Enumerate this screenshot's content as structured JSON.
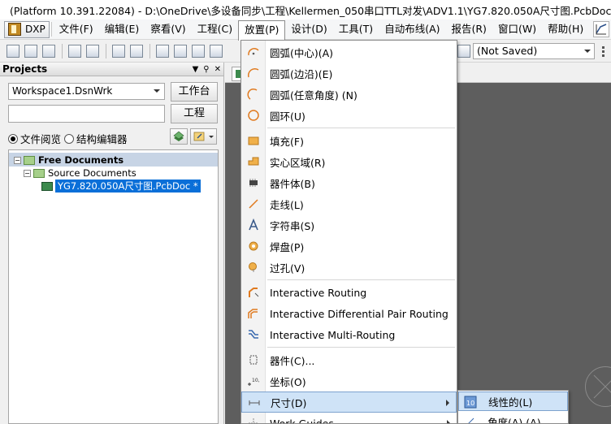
{
  "titlebar": {
    "title": "(Platform 10.391.22084) - D:\\OneDrive\\多设备同步\\工程\\Kellermen_050串口TTL对发\\ADV1.1\\YG7.820.050A尺寸图.PcbDoc * - Fre"
  },
  "menubar": {
    "dxp": "DXP",
    "items": [
      {
        "label": "文件(F)",
        "active": false
      },
      {
        "label": "编辑(E)",
        "active": false
      },
      {
        "label": "察看(V)",
        "active": false
      },
      {
        "label": "工程(C)",
        "active": false
      },
      {
        "label": "放置(P)",
        "active": true
      },
      {
        "label": "设计(D)",
        "active": false
      },
      {
        "label": "工具(T)",
        "active": false
      },
      {
        "label": "自动布线(A)",
        "active": false
      },
      {
        "label": "报告(R)",
        "active": false
      },
      {
        "label": "窗口(W)",
        "active": false
      },
      {
        "label": "帮助(H)",
        "active": false
      }
    ]
  },
  "toolbar": {
    "variant_value": "(Not Saved)"
  },
  "projects_panel": {
    "title": "Projects",
    "workspace_value": "Workspace1.DsnWrk",
    "workspace_button": "工作台",
    "project_button": "工程",
    "search_value": "",
    "radio_file_view": "文件阅览",
    "radio_struct_editor": "结构编辑器",
    "tree": {
      "free_documents": "Free Documents",
      "source_documents": "Source Documents",
      "file": "YG7.820.050A尺寸图.PcbDoc *"
    }
  },
  "place_menu": {
    "items": [
      {
        "label": "圆弧(中心)(A)",
        "icon": "arc-center-icon"
      },
      {
        "label": "圆弧(边沿)(E)",
        "icon": "arc-edge-icon"
      },
      {
        "label": "圆弧(任意角度) (N)",
        "icon": "arc-any-angle-icon"
      },
      {
        "label": "圆环(U)",
        "icon": "full-circle-icon"
      },
      {
        "label": "填充(F)",
        "icon": "fill-icon"
      },
      {
        "label": "实心区域(R)",
        "icon": "solid-region-icon"
      },
      {
        "label": "器件体(B)",
        "icon": "component-body-icon"
      },
      {
        "label": "走线(L)",
        "icon": "line-icon"
      },
      {
        "label": "字符串(S)",
        "icon": "string-icon"
      },
      {
        "label": "焊盘(P)",
        "icon": "pad-icon"
      },
      {
        "label": "过孔(V)",
        "icon": "via-icon"
      },
      {
        "label": "Interactive Routing",
        "icon": "interactive-routing-icon"
      },
      {
        "label": "Interactive Differential Pair Routing",
        "icon": "diff-pair-routing-icon"
      },
      {
        "label": "Interactive Multi-Routing",
        "icon": "multi-routing-icon"
      },
      {
        "label": "器件(C)...",
        "icon": "component-icon"
      },
      {
        "label": "坐标(O)",
        "icon": "coordinate-icon"
      },
      {
        "label": "尺寸(D)",
        "icon": "dimension-icon"
      },
      {
        "label": "Work Guides",
        "icon": "work-guides-icon"
      }
    ]
  },
  "dimension_submenu": {
    "items": [
      {
        "label": "线性的(L)",
        "icon": "linear-dimension-icon"
      },
      {
        "label": "角度(A) (A)",
        "icon": "angular-dimension-icon"
      }
    ]
  },
  "colors": {
    "selection": "#0a6fd8",
    "highlight": "#cfe3f7",
    "workspace": "#5e5e5e"
  }
}
